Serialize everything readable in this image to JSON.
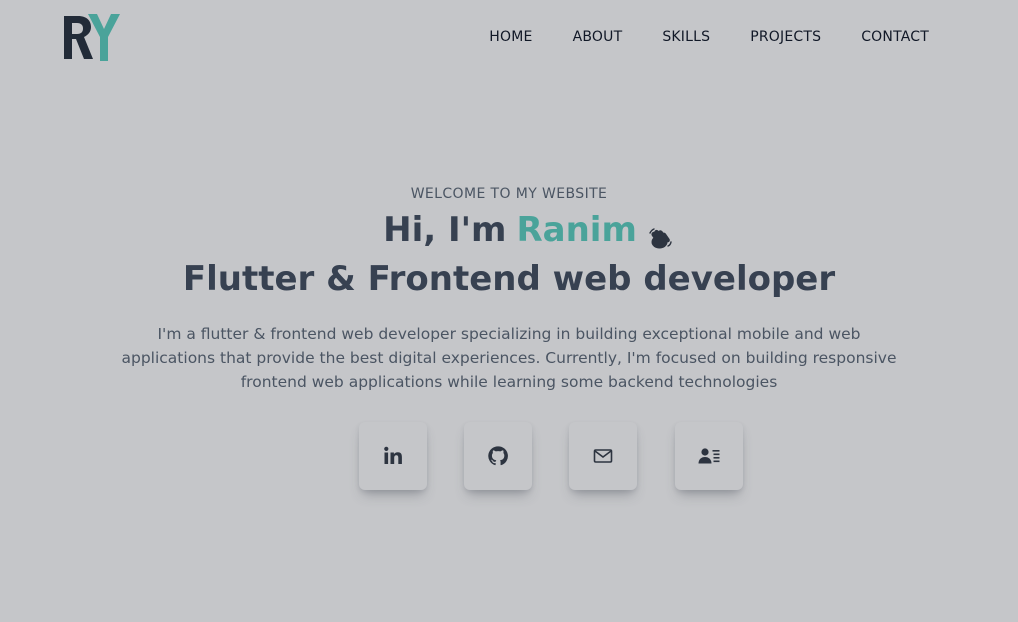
{
  "logo": {
    "letters": "RY",
    "colors": {
      "r": "#222b38",
      "y": "#4aa39a"
    }
  },
  "nav": {
    "items": [
      {
        "label": "HOME"
      },
      {
        "label": "ABOUT"
      },
      {
        "label": "SKILLS"
      },
      {
        "label": "PROJECTS"
      },
      {
        "label": "CONTACT"
      }
    ]
  },
  "hero": {
    "welcome": "WELCOME TO MY WEBSITE",
    "greeting_prefix": "Hi, I'm",
    "name": "Ranim",
    "wave_icon": "waving-hand-icon",
    "role": "Flutter & Frontend web developer",
    "description": "I'm a flutter & frontend web developer specializing in building exceptional mobile and web applications that provide the best digital experiences. Currently, I'm focused on building responsive frontend web applications while learning some backend technologies"
  },
  "social": [
    {
      "icon": "linkedin-icon"
    },
    {
      "icon": "github-icon"
    },
    {
      "icon": "mail-icon"
    },
    {
      "icon": "contact-card-icon"
    }
  ],
  "colors": {
    "background": "#c5c6c9",
    "accent": "#4aa39a",
    "text": "#374151"
  }
}
